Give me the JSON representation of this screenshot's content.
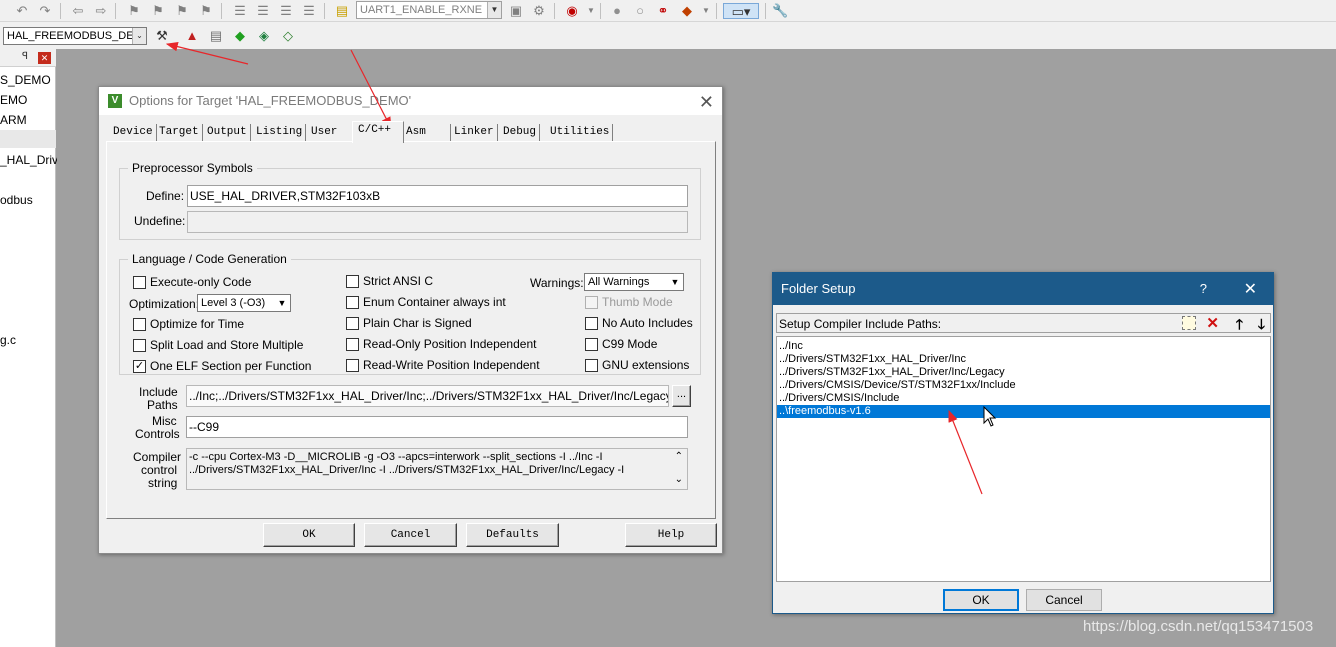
{
  "toolbar": {
    "target_combo": "UART1_ENABLE_RXNE",
    "project_combo": "HAL_FREEMODBUS_DEM"
  },
  "project_panel": {
    "items": [
      "S_DEMO",
      "EMO",
      "ARM",
      "_HAL_Driv",
      "odbus",
      "g.c"
    ]
  },
  "options_dialog": {
    "title": "Options for Target 'HAL_FREEMODBUS_DEMO'",
    "tabs": [
      "Device",
      "Target",
      "Output",
      "Listing",
      "User",
      "C/C++",
      "Asm",
      "Linker",
      "Debug",
      "Utilities"
    ],
    "active_tab": "C/C++",
    "preprocessor": {
      "group_label": "Preprocessor Symbols",
      "define_label": "Define:",
      "define_value": "USE_HAL_DRIVER,STM32F103xB",
      "undefine_label": "Undefine:",
      "undefine_value": ""
    },
    "language": {
      "group_label": "Language / Code Generation",
      "execute_only": "Execute-only Code",
      "optimization_label": "Optimization:",
      "optimization_value": "Level 3 (-O3)",
      "optimize_time": "Optimize for Time",
      "split_load": "Split Load and Store Multiple",
      "one_elf": "One ELF Section per Function",
      "strict_ansi": "Strict ANSI C",
      "enum_container": "Enum Container always int",
      "plain_char": "Plain Char is Signed",
      "ro_pi": "Read-Only Position Independent",
      "rw_pi": "Read-Write Position Independent",
      "warnings_label": "Warnings:",
      "warnings_value": "All Warnings",
      "thumb_mode": "Thumb Mode",
      "no_auto_includes": "No Auto Includes",
      "c99_mode": "C99 Mode",
      "gnu_ext": "GNU extensions"
    },
    "include_paths_label_1": "Include",
    "include_paths_label_2": "Paths",
    "include_paths_value": "../Inc;../Drivers/STM32F1xx_HAL_Driver/Inc;../Drivers/STM32F1xx_HAL_Driver/Inc/Legacy;../Driv",
    "browse_label": "...",
    "misc_label_1": "Misc",
    "misc_label_2": "Controls",
    "misc_value": "--C99",
    "compiler_label_1": "Compiler",
    "compiler_label_2": "control",
    "compiler_label_3": "string",
    "compiler_line_1": "-c --cpu Cortex-M3 -D__MICROLIB -g -O3 --apcs=interwork --split_sections -I ../Inc -I",
    "compiler_line_2": "../Drivers/STM32F1xx_HAL_Driver/Inc -I ../Drivers/STM32F1xx_HAL_Driver/Inc/Legacy -I",
    "buttons": {
      "ok": "OK",
      "cancel": "Cancel",
      "defaults": "Defaults",
      "help": "Help"
    }
  },
  "folder_dialog": {
    "title": "Folder Setup",
    "help": "?",
    "header": "Setup Compiler Include Paths:",
    "paths": [
      "../Inc",
      "../Drivers/STM32F1xx_HAL_Driver/Inc",
      "../Drivers/STM32F1xx_HAL_Driver/Inc/Legacy",
      "../Drivers/CMSIS/Device/ST/STM32F1xx/Include",
      "../Drivers/CMSIS/Include",
      "..\\freemodbus-v1.6"
    ],
    "selected_index": 5,
    "ok": "OK",
    "cancel": "Cancel"
  },
  "watermark": "https://blog.csdn.net/qq153471503",
  "colors": {
    "annotation_arrow": "#e8262a",
    "selection": "#0078d7",
    "folder_title_bar": "#1c5a8a"
  }
}
